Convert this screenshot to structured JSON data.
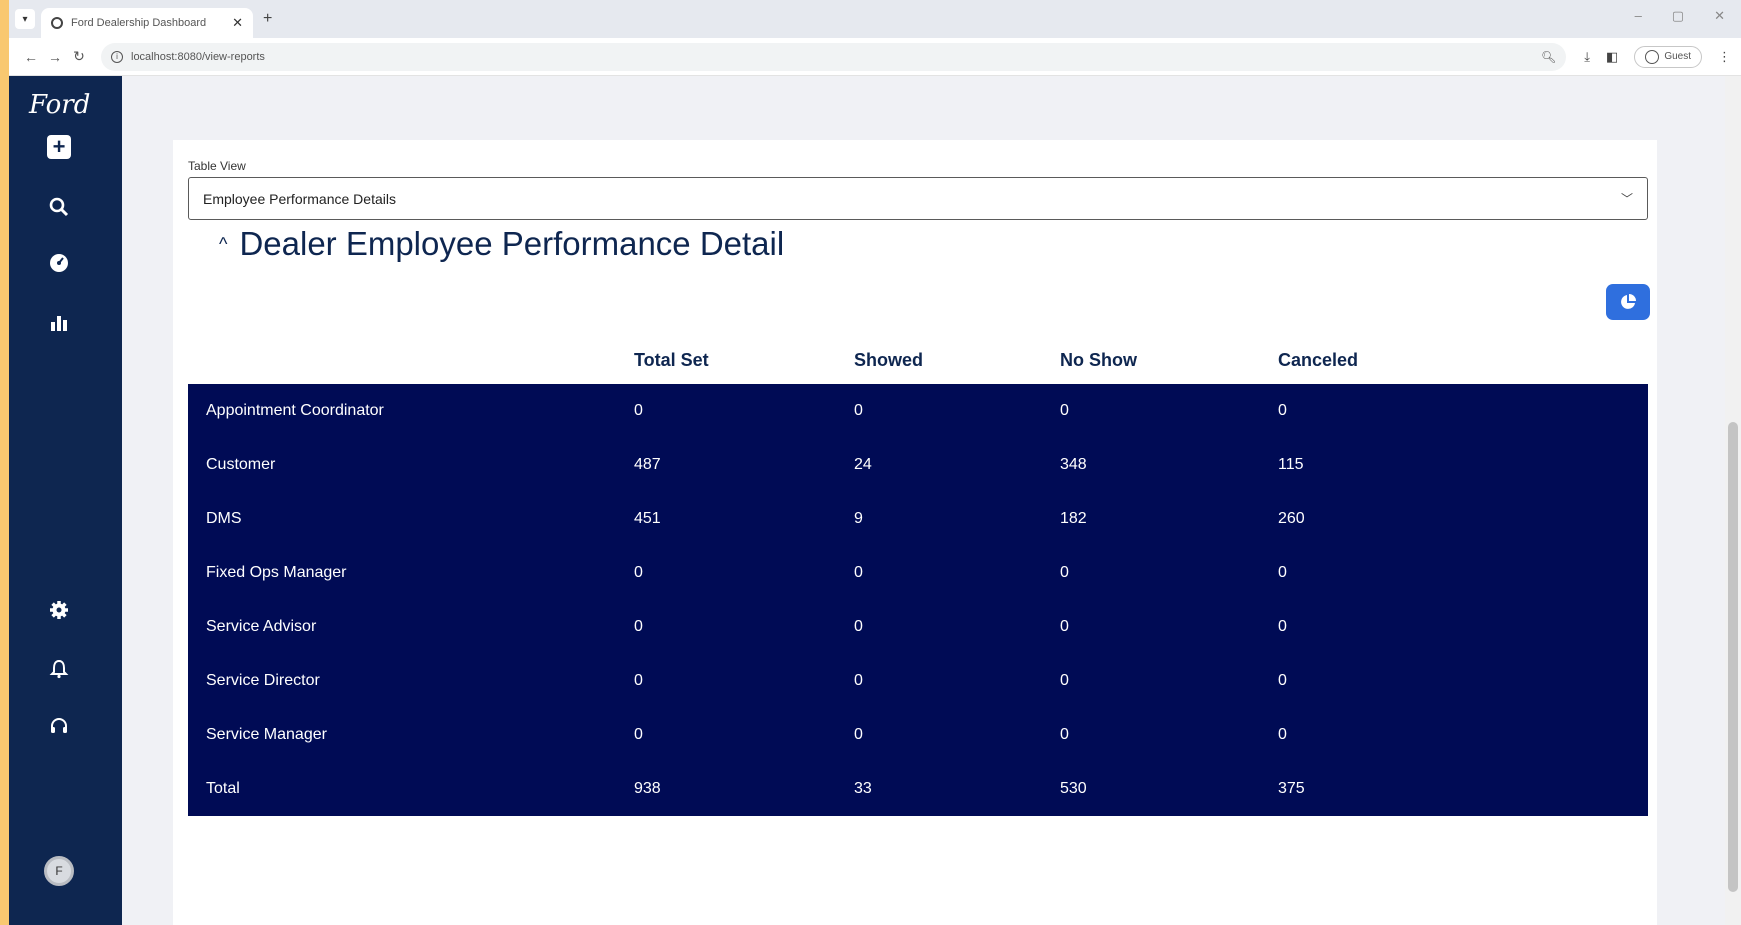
{
  "browser": {
    "tab_title": "Ford Dealership Dashboard",
    "url": "localhost:8080/view-reports",
    "profile_label": "Guest"
  },
  "sidebar": {
    "logo_text": "Ford",
    "nav_icons": [
      "plus-icon",
      "search-icon",
      "dashboard-gauge-icon",
      "bar-chart-icon"
    ],
    "bottom_icons": [
      "gear-icon",
      "bell-icon",
      "headset-icon"
    ],
    "avatar_initial": "F"
  },
  "table_view": {
    "label": "Table View",
    "selected": "Employee Performance Details"
  },
  "section": {
    "title": "Dealer Employee Performance Detail"
  },
  "table": {
    "columns": [
      "",
      "Total Set",
      "Showed",
      "No Show",
      "Canceled"
    ],
    "rows": [
      {
        "role": "Appointment Coordinator",
        "total_set": "0",
        "showed": "0",
        "no_show": "0",
        "canceled": "0"
      },
      {
        "role": "Customer",
        "total_set": "487",
        "showed": "24",
        "no_show": "348",
        "canceled": "115"
      },
      {
        "role": "DMS",
        "total_set": "451",
        "showed": "9",
        "no_show": "182",
        "canceled": "260"
      },
      {
        "role": "Fixed Ops Manager",
        "total_set": "0",
        "showed": "0",
        "no_show": "0",
        "canceled": "0"
      },
      {
        "role": "Service Advisor",
        "total_set": "0",
        "showed": "0",
        "no_show": "0",
        "canceled": "0"
      },
      {
        "role": "Service Director",
        "total_set": "0",
        "showed": "0",
        "no_show": "0",
        "canceled": "0"
      },
      {
        "role": "Service Manager",
        "total_set": "0",
        "showed": "0",
        "no_show": "0",
        "canceled": "0"
      },
      {
        "role": "Total",
        "total_set": "938",
        "showed": "33",
        "no_show": "530",
        "canceled": "375"
      }
    ]
  },
  "colors": {
    "sidebar_bg": "#0e2650",
    "table_body_bg": "#000b55",
    "accent_button": "#2f6fde",
    "outer_frame": "#f9c870"
  }
}
